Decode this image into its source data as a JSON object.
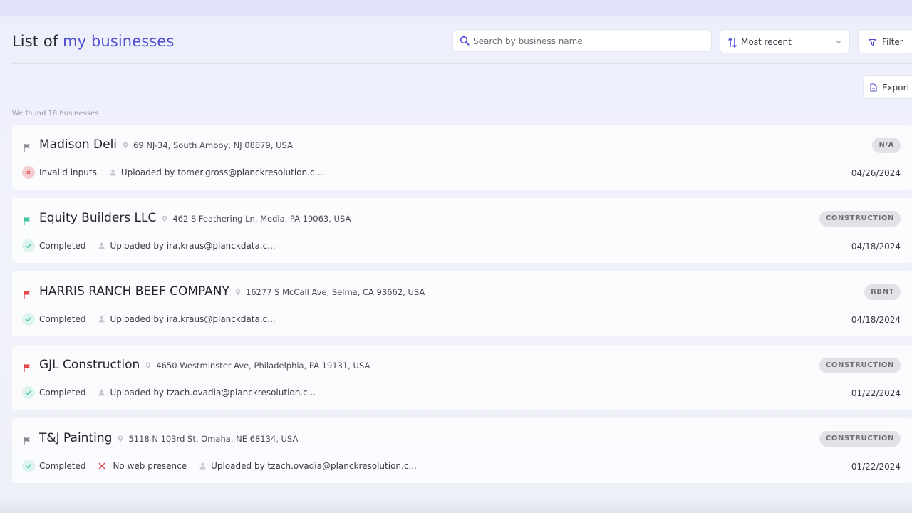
{
  "header": {
    "title_prefix": "List of",
    "title_accent": "my businesses",
    "search_placeholder": "Search by business name",
    "sort_label": "Most recent",
    "filter_label": "Filter",
    "export_label": "Export"
  },
  "results_text": "We found 18 businesses",
  "businesses": [
    {
      "name": "Madison Deli",
      "address": "69 NJ-34, South Amboy, NJ 08879, USA",
      "badge": "N/A",
      "flag_color": "#8a8a94",
      "status": "Invalid inputs",
      "status_kind": "error",
      "no_web_presence": "",
      "uploader": "Uploaded by tomer.gross@planckresolution.c...",
      "date": "04/26/2024"
    },
    {
      "name": "Equity Builders LLC",
      "address": "462 S Feathering Ln, Media, PA 19063, USA",
      "badge": "CONSTRUCTION",
      "flag_color": "#3fc6a0",
      "status": "Completed",
      "status_kind": "ok",
      "no_web_presence": "",
      "uploader": "Uploaded by ira.kraus@planckdata.c...",
      "date": "04/18/2024"
    },
    {
      "name": "HARRIS RANCH BEEF COMPANY",
      "address": "16277 S McCall Ave, Selma, CA 93662, USA",
      "badge": "RBNT",
      "flag_color": "#e0464b",
      "status": "Completed",
      "status_kind": "ok",
      "no_web_presence": "",
      "uploader": "Uploaded by ira.kraus@planckdata.c...",
      "date": "04/18/2024"
    },
    {
      "name": "GJL Construction",
      "address": "4650 Westminster Ave, Philadelphia, PA 19131, USA",
      "badge": "CONSTRUCTION",
      "flag_color": "#e0464b",
      "status": "Completed",
      "status_kind": "ok",
      "no_web_presence": "",
      "uploader": "Uploaded by tzach.ovadia@planckresolution.c...",
      "date": "01/22/2024"
    },
    {
      "name": "T&J Painting",
      "address": "5118 N 103rd St, Omaha, NE 68134, USA",
      "badge": "CONSTRUCTION",
      "flag_color": "#8a8a94",
      "status": "Completed",
      "status_kind": "ok",
      "no_web_presence": "No web presence",
      "uploader": "Uploaded by tzach.ovadia@planckresolution.c...",
      "date": "01/22/2024"
    }
  ],
  "icons": {
    "search": "search-icon",
    "sort": "sort-arrows-icon",
    "chevron": "chevron-down-icon",
    "filter": "filter-funnel-icon",
    "export": "export-file-icon",
    "flag": "flag-icon",
    "pin": "location-pin-icon",
    "user": "user-icon",
    "check": "check-icon",
    "error": "close-icon"
  },
  "colors": {
    "accent": "#4f4fd0",
    "ok": "#3fc6a0",
    "error": "#e0464b",
    "badge_bg": "#e2e2e6"
  }
}
